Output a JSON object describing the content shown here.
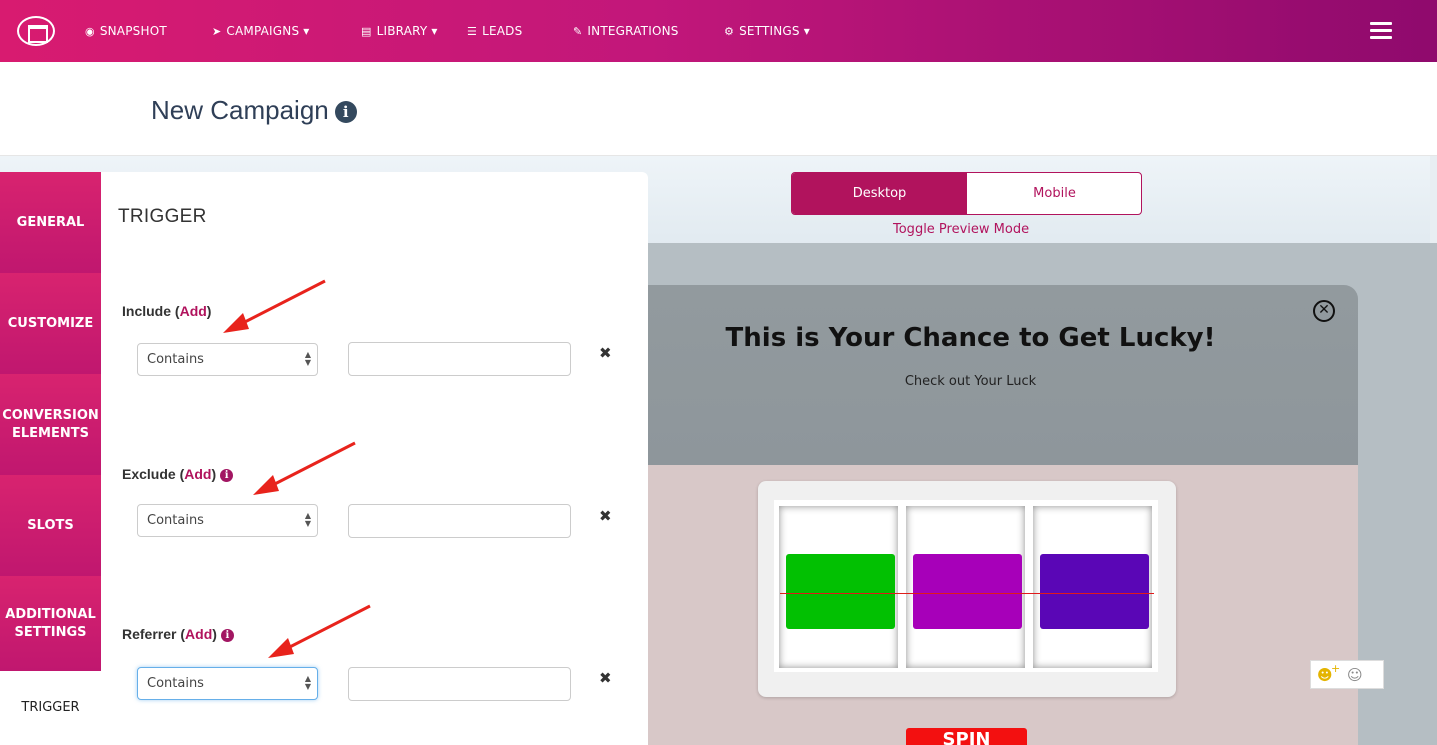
{
  "nav": {
    "items": [
      {
        "icon": "dashboard-icon",
        "glyph": "◉",
        "label": "SNAPSHOT"
      },
      {
        "icon": "paper-plane-icon",
        "glyph": "➤",
        "label": "CAMPAIGNS ▾"
      },
      {
        "icon": "library-icon",
        "glyph": "▤",
        "label": "LIBRARY ▾"
      },
      {
        "icon": "list-icon",
        "glyph": "☰",
        "label": "LEADS"
      },
      {
        "icon": "plug-icon",
        "glyph": "✎",
        "label": "INTEGRATIONS"
      },
      {
        "icon": "cogs-icon",
        "glyph": "⚙",
        "label": "SETTINGS ▾"
      }
    ]
  },
  "page": {
    "title": "New Campaign",
    "info_glyph": "i"
  },
  "sidebar": {
    "items": [
      {
        "label": "GENERAL"
      },
      {
        "label": "CUSTOMIZE"
      },
      {
        "label": "CONVERSION ELEMENTS"
      },
      {
        "label": "SLOTS"
      },
      {
        "label": "ADDITIONAL SETTINGS"
      },
      {
        "label": "TRIGGER"
      }
    ]
  },
  "trigger": {
    "heading": "TRIGGER",
    "add_label": "Add",
    "rules": [
      {
        "name": "Include",
        "has_info": false,
        "select": "Contains",
        "value": ""
      },
      {
        "name": "Exclude",
        "has_info": true,
        "select": "Contains",
        "value": ""
      },
      {
        "name": "Referrer",
        "has_info": true,
        "select": "Contains",
        "value": ""
      }
    ],
    "remove_glyph": "✖"
  },
  "preview": {
    "toggle": {
      "desktop": "Desktop",
      "mobile": "Mobile",
      "active": "Desktop",
      "caption": "Toggle Preview Mode"
    },
    "popup_title": "This is Your Chance to Get Lucky!",
    "popup_subtitle": "Check out Your Luck",
    "close_glyph": "✕",
    "reels": [
      {
        "color": "#02c002"
      },
      {
        "color": "#a700b9"
      },
      {
        "color": "#5a06b6"
      }
    ],
    "spin_label": "SPIN"
  },
  "colors": {
    "brand": "#c2177a",
    "accent": "#b1135d",
    "payline": "#e01a1a"
  }
}
